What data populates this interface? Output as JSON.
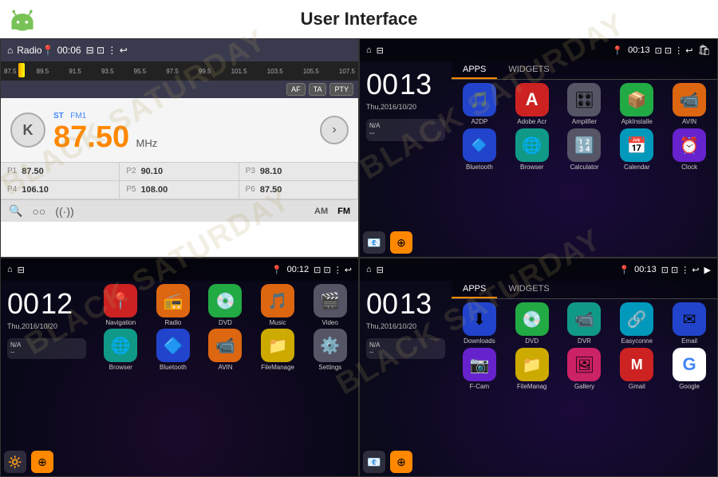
{
  "header": {
    "title": "User Interface"
  },
  "screen1": {
    "title": "Radio",
    "time": "00:06",
    "freqScaleValues": [
      "87.5",
      "89.5",
      "91.5",
      "93.5",
      "95.5",
      "97.5",
      "99.5",
      "101.5",
      "103.5",
      "105.5",
      "107.5"
    ],
    "buttons": [
      "AF",
      "TA",
      "PTY"
    ],
    "kLabel": "K",
    "stLabel": "ST",
    "fmLabel": "FM1",
    "frequency": "87.50",
    "mhz": "MHz",
    "presets": [
      {
        "label": "P1",
        "value": "87.50"
      },
      {
        "label": "P2",
        "value": "90.10"
      },
      {
        "label": "P3",
        "value": "98.10"
      },
      {
        "label": "P4",
        "value": "106.10"
      },
      {
        "label": "P5",
        "value": "108.00"
      },
      {
        "label": "P6",
        "value": "87.50"
      }
    ],
    "modes": [
      "AM",
      "FM"
    ]
  },
  "screen2": {
    "time": "00:13",
    "date": "Thu,2016/10/20",
    "tabs": [
      "APPS",
      "WIDGETS"
    ],
    "apps": [
      {
        "label": "A2DP",
        "color": "ic-blue",
        "icon": "🎵"
      },
      {
        "label": "Adobe Acr",
        "color": "ic-red",
        "icon": "📄"
      },
      {
        "label": "Amplifier",
        "color": "ic-gray",
        "icon": "🎛"
      },
      {
        "label": "ApkInstalle",
        "color": "ic-green",
        "icon": "📦"
      },
      {
        "label": "AVIN",
        "color": "ic-orange",
        "icon": "📹"
      },
      {
        "label": "Bluetooth",
        "color": "ic-blue",
        "icon": "🔷"
      },
      {
        "label": "Browser",
        "color": "ic-teal",
        "icon": "🌐"
      },
      {
        "label": "Calculator",
        "color": "ic-gray",
        "icon": "🔢"
      },
      {
        "label": "Calendar",
        "color": "ic-cyan",
        "icon": "📅"
      },
      {
        "label": "Clock",
        "color": "ic-purple",
        "icon": "⏰"
      }
    ]
  },
  "screen3": {
    "time": "00:12",
    "date": "Thu,2016/10/20",
    "apps": [
      {
        "label": "Navigation",
        "color": "ic-red",
        "icon": "📍"
      },
      {
        "label": "Radio",
        "color": "ic-orange",
        "icon": "📻"
      },
      {
        "label": "DVD",
        "color": "ic-green",
        "icon": "💿"
      },
      {
        "label": "Music",
        "color": "ic-orange",
        "icon": "🎵"
      },
      {
        "label": "Video",
        "color": "ic-gray",
        "icon": "🎬"
      },
      {
        "label": "Browser",
        "color": "ic-teal",
        "icon": "🌐"
      },
      {
        "label": "Bluetooth",
        "color": "ic-blue",
        "icon": "🔷"
      },
      {
        "label": "AVIN",
        "color": "ic-orange",
        "icon": "📹"
      },
      {
        "label": "FileManage",
        "color": "ic-yellow",
        "icon": "📁"
      },
      {
        "label": "Settings",
        "color": "ic-gray",
        "icon": "⚙️"
      }
    ]
  },
  "screen4": {
    "time": "00:13",
    "date": "Thu,2016/10/20",
    "tabs": [
      "APPS",
      "WIDGETS"
    ],
    "apps": [
      {
        "label": "Downloads",
        "color": "ic-blue",
        "icon": "⬇"
      },
      {
        "label": "DVD",
        "color": "ic-green",
        "icon": "💿"
      },
      {
        "label": "DVR",
        "color": "ic-teal",
        "icon": "📹"
      },
      {
        "label": "Easyconne",
        "color": "ic-cyan",
        "icon": "🔗"
      },
      {
        "label": "Email",
        "color": "ic-blue",
        "icon": "✉"
      },
      {
        "label": "F-Cam",
        "color": "ic-purple",
        "icon": "📷"
      },
      {
        "label": "FileManag",
        "color": "ic-yellow",
        "icon": "📁"
      },
      {
        "label": "Gallery",
        "color": "ic-pink",
        "icon": "🖼"
      },
      {
        "label": "Gmail",
        "color": "ic-red",
        "icon": "✉"
      },
      {
        "label": "Google",
        "color": "ic-red",
        "icon": "G"
      }
    ]
  },
  "watermarks": [
    "BLACK SATURDAY",
    "BLACK SATURDAY",
    "BLACK SATURDAY",
    "BLACK SATURDAY"
  ]
}
